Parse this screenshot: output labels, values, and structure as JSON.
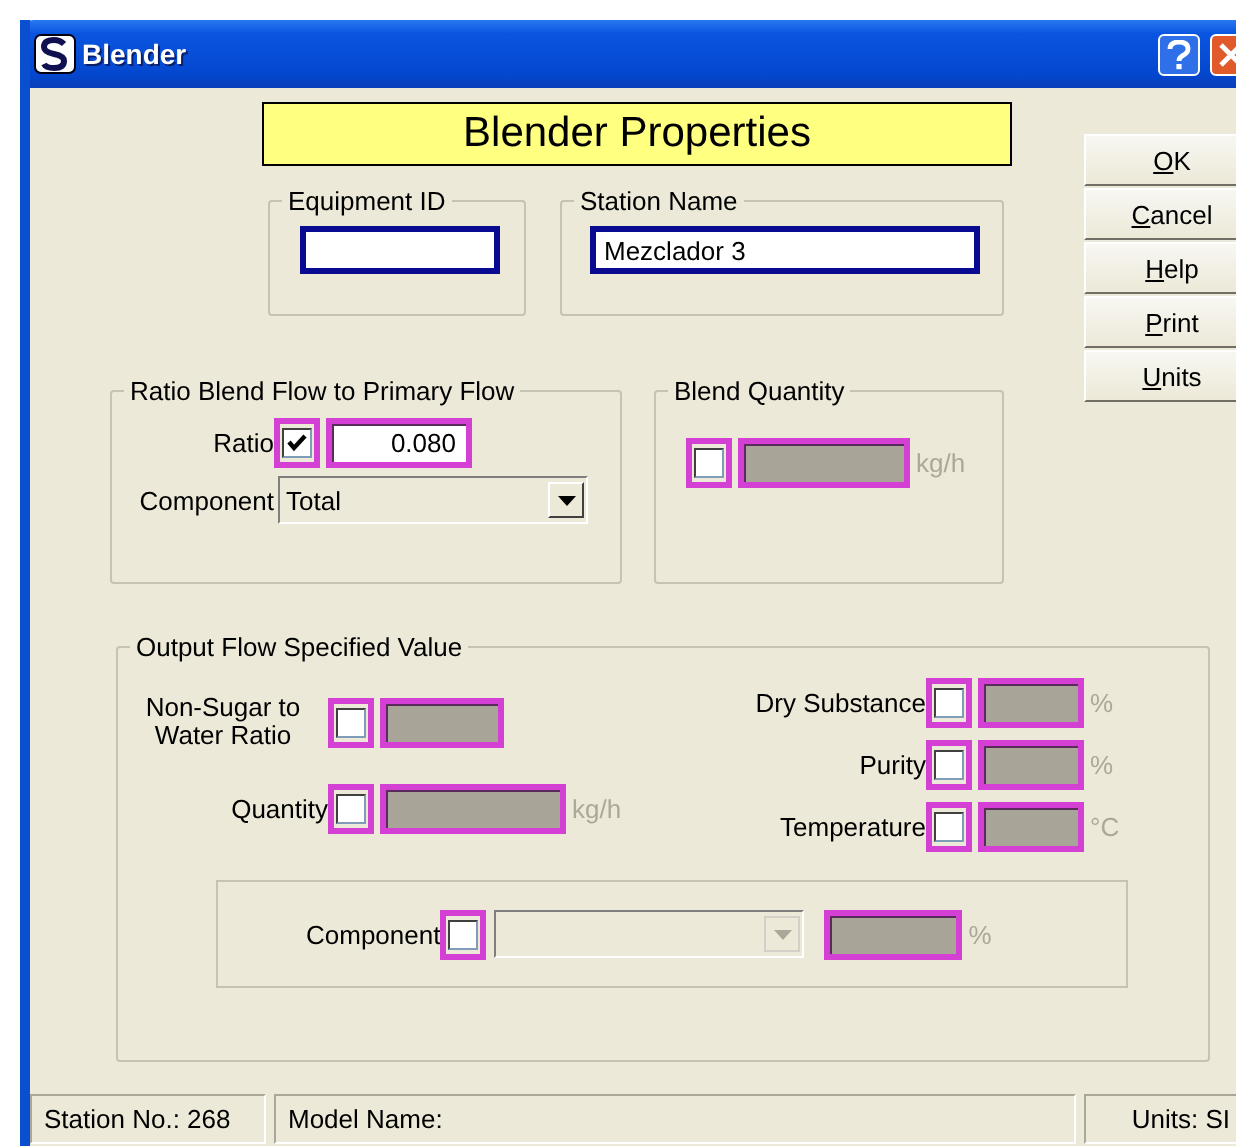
{
  "window": {
    "title": "Blender"
  },
  "header": "Blender Properties",
  "buttons": [
    {
      "key": "O",
      "rest": "K"
    },
    {
      "key": "C",
      "rest": "ancel"
    },
    {
      "key": "H",
      "rest": "elp"
    },
    {
      "key": "P",
      "rest": "rint"
    },
    {
      "key": "U",
      "rest": "nits"
    }
  ],
  "identity": [
    {
      "label": "Equipment ID",
      "highlighted": false
    },
    {
      "label": "Station Name",
      "value": "Mezclador 3",
      "highlighted": false
    }
  ],
  "ratio_group": {
    "title": "Ratio Blend Flow to Primary Flow",
    "ratio": {
      "label": "Ratio",
      "checked": true,
      "value": "0.080",
      "disabled": false,
      "highlighted": true
    },
    "component": {
      "label": "Component",
      "value": "Total"
    }
  },
  "blend_quantity": {
    "title": "Blend Quantity",
    "checked": false,
    "disabled": true,
    "highlighted": true,
    "unit": "kg/h"
  },
  "output": {
    "title": "Output Flow Specified Value",
    "left": [
      {
        "label": "Non-Sugar to Water Ratio",
        "checked": false,
        "disabled": true,
        "highlighted": true
      },
      {
        "label": "Quantity",
        "checked": false,
        "disabled": true,
        "highlighted": true,
        "unit": "kg/h"
      }
    ],
    "right": [
      {
        "label": "Dry Substance",
        "checked": false,
        "disabled": true,
        "highlighted": true,
        "unit": "%"
      },
      {
        "label": "Purity",
        "checked": false,
        "disabled": true,
        "highlighted": true,
        "unit": "%"
      },
      {
        "label": "Temperature",
        "checked": false,
        "disabled": true,
        "highlighted": true,
        "unit": "°C"
      }
    ],
    "component_row": {
      "label": "Component",
      "checked": false,
      "disabled": true,
      "highlighted": true,
      "unit": "%"
    }
  },
  "status_bar": [
    "Station No.: 268",
    "Model Name:",
    "Units: SI"
  ]
}
